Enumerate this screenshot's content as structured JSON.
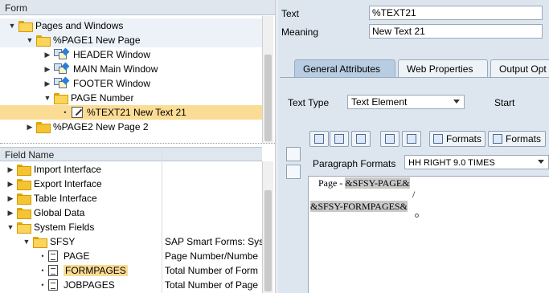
{
  "form_tree": {
    "header": "Form",
    "nodes": [
      {
        "label": "Pages and Windows",
        "depth": 1,
        "toggle": "▼",
        "icon": "folder-open-icon"
      },
      {
        "label": "%PAGE1 New Page",
        "depth": 2,
        "toggle": "▼",
        "icon": "folder-open-icon"
      },
      {
        "label": "HEADER Window",
        "depth": 3,
        "toggle": "▶",
        "icon": "window-icon"
      },
      {
        "label": "MAIN Main Window",
        "depth": 3,
        "toggle": "▶",
        "icon": "window-icon"
      },
      {
        "label": "FOOTER Window",
        "depth": 3,
        "toggle": "▶",
        "icon": "window-icon"
      },
      {
        "label": "PAGE Number",
        "depth": 3,
        "toggle": "▼",
        "icon": "folder-open-icon"
      },
      {
        "label": "%TEXT21 New Text 21",
        "depth": 4,
        "toggle": "•",
        "icon": "text-edit-icon",
        "selected": true
      },
      {
        "label": "%PAGE2 New Page 2",
        "depth": 2,
        "toggle": "▶",
        "icon": "folder-icon"
      }
    ]
  },
  "field_list": {
    "col1_header": "Field Name",
    "rows": [
      {
        "name": "Import Interface",
        "desc": "",
        "toggle": "▶",
        "icon": "folder-icon",
        "depth": 1
      },
      {
        "name": "Export Interface",
        "desc": "",
        "toggle": "▶",
        "icon": "folder-icon",
        "depth": 1
      },
      {
        "name": "Table Interface",
        "desc": "",
        "toggle": "▶",
        "icon": "folder-icon",
        "depth": 1
      },
      {
        "name": "Global Data",
        "desc": "",
        "toggle": "▶",
        "icon": "folder-icon",
        "depth": 1
      },
      {
        "name": "System Fields",
        "desc": "",
        "toggle": "▼",
        "icon": "folder-open-icon",
        "depth": 1
      },
      {
        "name": "SFSY",
        "desc": "SAP Smart Forms: Sys",
        "toggle": "▼",
        "icon": "folder-open-icon",
        "depth": 2
      },
      {
        "name": "PAGE",
        "desc": "Page Number/Numbe",
        "toggle": "•",
        "icon": "doc-icon",
        "depth": 3
      },
      {
        "name": "FORMPAGES",
        "desc": "Total Number of Form",
        "toggle": "•",
        "icon": "doc-icon",
        "depth": 3,
        "highlight": true
      },
      {
        "name": "JOBPAGES",
        "desc": "Total Number of Page",
        "toggle": "•",
        "icon": "doc-icon",
        "depth": 3
      }
    ]
  },
  "node_attrs": {
    "text_label": "Text",
    "text_value": "%TEXT21",
    "meaning_label": "Meaning",
    "meaning_value": "New Text 21"
  },
  "tabs": [
    "General Attributes",
    "Web Properties",
    "Output Opt"
  ],
  "general": {
    "text_type_label": "Text Type",
    "text_type_value": "Text Element",
    "start_label": "Start"
  },
  "toolbar": {
    "formats1": "Formats",
    "formats2": "Formats"
  },
  "paragraph": {
    "label": "Paragraph Formats",
    "value": "HH RIGHT 9.0 TIMES"
  },
  "editor": {
    "line1_prefix": "Page - ",
    "line1_field": "&SFSY-PAGE&",
    "line2_sep": "/",
    "line3_field": "&SFSY-FORMPAGES&"
  }
}
